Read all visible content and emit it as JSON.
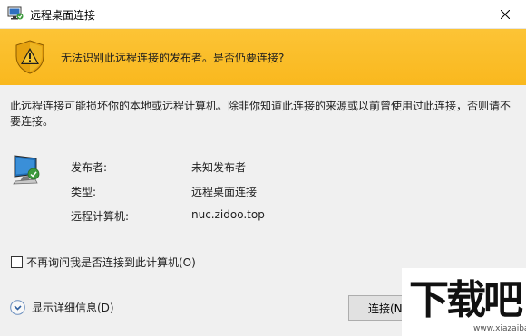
{
  "window": {
    "title": "远程桌面连接",
    "close_icon": "close-icon"
  },
  "banner": {
    "icon": "warning-shield-icon",
    "message": "无法识别此远程连接的发布者。是否仍要连接?",
    "color": "#f9b81e"
  },
  "body": {
    "warning": "此远程连接可能损坏你的本地或远程计算机。除非你知道此连接的来源或以前曾使用过此连接，否则请不要连接。",
    "icon": "remote-computer-icon",
    "info": [
      {
        "label": "发布者:",
        "value": "未知发布者"
      },
      {
        "label": "类型:",
        "value": "远程桌面连接"
      },
      {
        "label": "远程计算机:",
        "value": "nuc.zidoo.top"
      }
    ],
    "checkbox": {
      "label": "不再询问我是否连接到此计算机(O)",
      "checked": false
    },
    "details": {
      "label": "显示详细信息(D)",
      "icon": "expand-chevron-icon"
    },
    "connect_button": "连接(N)"
  },
  "watermark": {
    "big": "下载吧",
    "small": "www.xiazaiba.com"
  }
}
